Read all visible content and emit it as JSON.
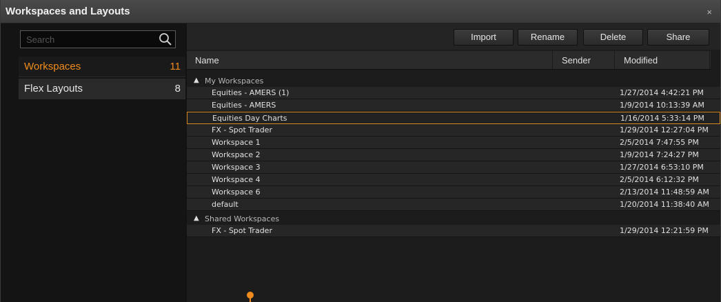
{
  "window": {
    "title": "Workspaces and Layouts",
    "close": "×"
  },
  "search": {
    "placeholder": "Search"
  },
  "sidebar": {
    "items": [
      {
        "label": "Workspaces",
        "count": "11"
      },
      {
        "label": "Flex Layouts",
        "count": "8"
      }
    ]
  },
  "toolbar": {
    "import": "Import",
    "rename": "Rename",
    "delete": "Delete",
    "share": "Share"
  },
  "columns": {
    "name": "Name",
    "sender": "Sender",
    "modified": "Modified"
  },
  "groups": [
    {
      "name": "My Workspaces",
      "rows": [
        {
          "name": "Equities - AMERS (1)",
          "modified": "1/27/2014 4:42:21 PM"
        },
        {
          "name": "Equities - AMERS",
          "modified": "1/9/2014 10:13:39 AM"
        },
        {
          "name": "Equities Day Charts",
          "modified": "1/16/2014 5:33:14 PM"
        },
        {
          "name": "FX - Spot Trader",
          "modified": "1/29/2014 12:27:04 PM"
        },
        {
          "name": "Workspace 1",
          "modified": "2/5/2014 7:47:55 PM"
        },
        {
          "name": "Workspace 2",
          "modified": "1/9/2014 7:24:27 PM"
        },
        {
          "name": "Workspace 3",
          "modified": "1/27/2014 6:53:10 PM"
        },
        {
          "name": "Workspace 4",
          "modified": "2/5/2014 6:12:32 PM"
        },
        {
          "name": "Workspace 6",
          "modified": "2/13/2014 11:48:59 AM"
        },
        {
          "name": "default",
          "modified": "1/20/2014 11:38:40 AM"
        }
      ]
    },
    {
      "name": "Shared Workspaces",
      "rows": [
        {
          "name": "FX - Spot Trader",
          "modified": "1/29/2014 12:21:59 PM"
        }
      ]
    }
  ],
  "selected_row": "Equities Day Charts",
  "colors": {
    "accent": "#f08c1e",
    "selection_border": "#d98a1e"
  }
}
